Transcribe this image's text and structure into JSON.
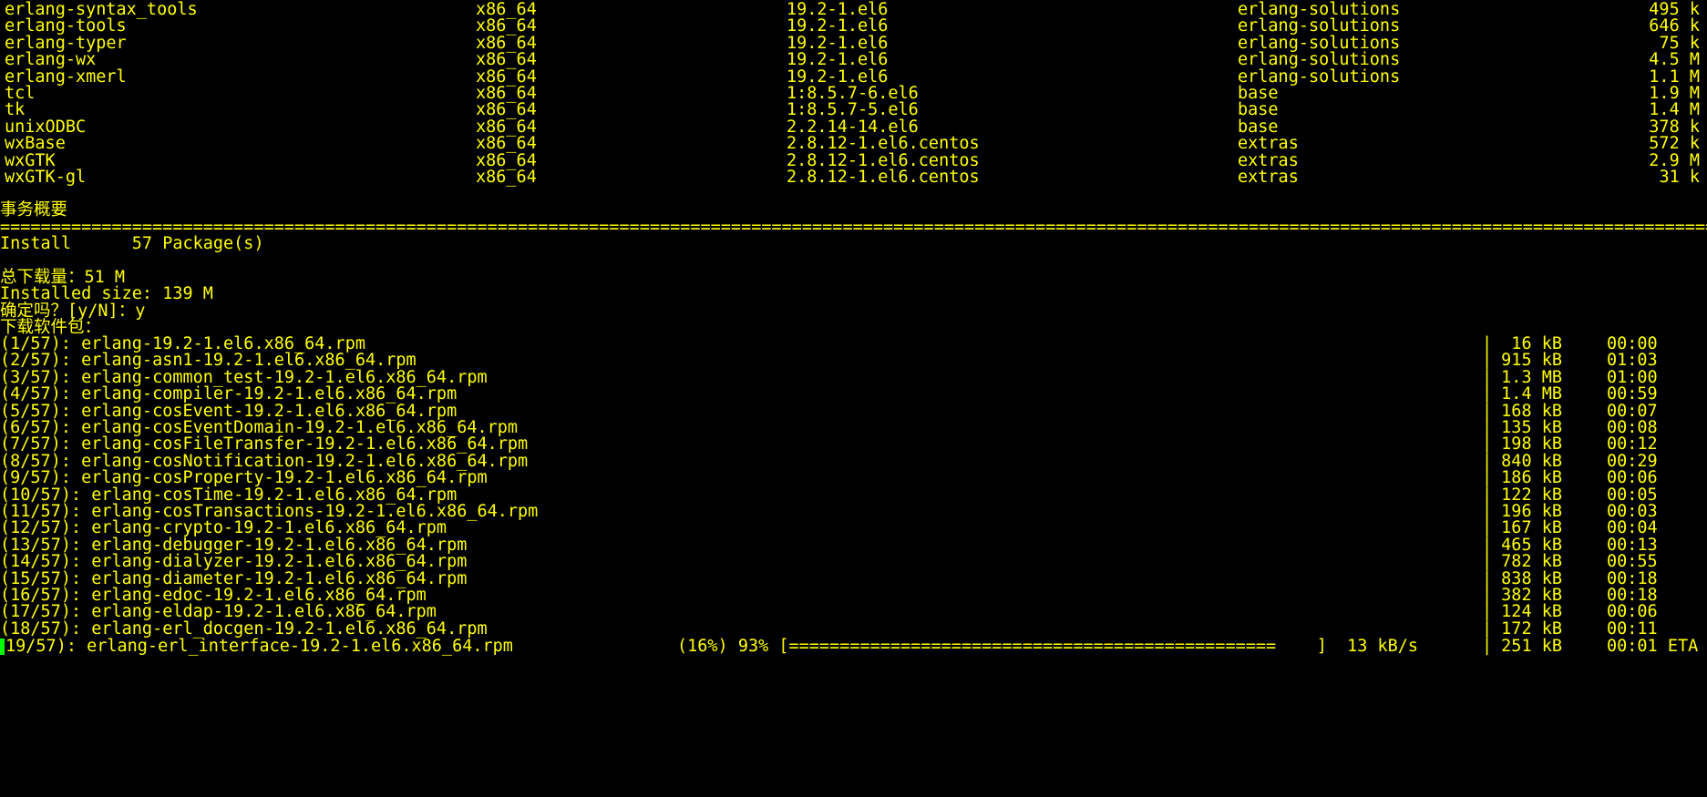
{
  "theme": {
    "foreground": "#ffff00",
    "background": "#000000",
    "cursor": "#00ff00"
  },
  "packages": [
    {
      "name": "erlang-syntax_tools",
      "arch": "x86_64",
      "version": "19.2-1.el6",
      "repo": "erlang-solutions",
      "size": "495 k"
    },
    {
      "name": "erlang-tools",
      "arch": "x86_64",
      "version": "19.2-1.el6",
      "repo": "erlang-solutions",
      "size": "646 k"
    },
    {
      "name": "erlang-typer",
      "arch": "x86_64",
      "version": "19.2-1.el6",
      "repo": "erlang-solutions",
      "size": "75 k"
    },
    {
      "name": "erlang-wx",
      "arch": "x86_64",
      "version": "19.2-1.el6",
      "repo": "erlang-solutions",
      "size": "4.5 M"
    },
    {
      "name": "erlang-xmerl",
      "arch": "x86_64",
      "version": "19.2-1.el6",
      "repo": "erlang-solutions",
      "size": "1.1 M"
    },
    {
      "name": "tcl",
      "arch": "x86_64",
      "version": "1:8.5.7-6.el6",
      "repo": "base",
      "size": "1.9 M"
    },
    {
      "name": "tk",
      "arch": "x86_64",
      "version": "1:8.5.7-5.el6",
      "repo": "base",
      "size": "1.4 M"
    },
    {
      "name": "unixODBC",
      "arch": "x86_64",
      "version": "2.2.14-14.el6",
      "repo": "base",
      "size": "378 k"
    },
    {
      "name": "wxBase",
      "arch": "x86_64",
      "version": "2.8.12-1.el6.centos",
      "repo": "extras",
      "size": "572 k"
    },
    {
      "name": "wxGTK",
      "arch": "x86_64",
      "version": "2.8.12-1.el6.centos",
      "repo": "extras",
      "size": "2.9 M"
    },
    {
      "name": "wxGTK-gl",
      "arch": "x86_64",
      "version": "2.8.12-1.el6.centos",
      "repo": "extras",
      "size": "31 k"
    }
  ],
  "summary": {
    "title": "事务概要",
    "separator_char": "=",
    "install_line": "Install      57 Package(s)",
    "download_total": "总下载量：51 M",
    "installed_size": "Installed size: 139 M",
    "confirm_prompt": "确定吗？[y/N]：y",
    "downloading": "下载软件包："
  },
  "downloads": [
    {
      "file": "(1/57): erlang-19.2-1.el6.x86_64.rpm",
      "size": " 16 kB",
      "time": "00:00"
    },
    {
      "file": "(2/57): erlang-asn1-19.2-1.el6.x86_64.rpm",
      "size": "915 kB",
      "time": "01:03"
    },
    {
      "file": "(3/57): erlang-common_test-19.2-1.el6.x86_64.rpm",
      "size": "1.3 MB",
      "time": "01:00"
    },
    {
      "file": "(4/57): erlang-compiler-19.2-1.el6.x86_64.rpm",
      "size": "1.4 MB",
      "time": "00:59"
    },
    {
      "file": "(5/57): erlang-cosEvent-19.2-1.el6.x86_64.rpm",
      "size": "168 kB",
      "time": "00:07"
    },
    {
      "file": "(6/57): erlang-cosEventDomain-19.2-1.el6.x86_64.rpm",
      "size": "135 kB",
      "time": "00:08"
    },
    {
      "file": "(7/57): erlang-cosFileTransfer-19.2-1.el6.x86_64.rpm",
      "size": "198 kB",
      "time": "00:12"
    },
    {
      "file": "(8/57): erlang-cosNotification-19.2-1.el6.x86_64.rpm",
      "size": "840 kB",
      "time": "00:29"
    },
    {
      "file": "(9/57): erlang-cosProperty-19.2-1.el6.x86_64.rpm",
      "size": "186 kB",
      "time": "00:06"
    },
    {
      "file": "(10/57): erlang-cosTime-19.2-1.el6.x86_64.rpm",
      "size": "122 kB",
      "time": "00:05"
    },
    {
      "file": "(11/57): erlang-cosTransactions-19.2-1.el6.x86_64.rpm",
      "size": "196 kB",
      "time": "00:03"
    },
    {
      "file": "(12/57): erlang-crypto-19.2-1.el6.x86_64.rpm",
      "size": "167 kB",
      "time": "00:04"
    },
    {
      "file": "(13/57): erlang-debugger-19.2-1.el6.x86_64.rpm",
      "size": "465 kB",
      "time": "00:13"
    },
    {
      "file": "(14/57): erlang-dialyzer-19.2-1.el6.x86_64.rpm",
      "size": "782 kB",
      "time": "00:55"
    },
    {
      "file": "(15/57): erlang-diameter-19.2-1.el6.x86_64.rpm",
      "size": "838 kB",
      "time": "00:18"
    },
    {
      "file": "(16/57): erlang-edoc-19.2-1.el6.x86_64.rpm",
      "size": "382 kB",
      "time": "00:18"
    },
    {
      "file": "(17/57): erlang-eldap-19.2-1.el6.x86_64.rpm",
      "size": "124 kB",
      "time": "00:06"
    },
    {
      "file": "(18/57): erlang-erl_docgen-19.2-1.el6.x86_64.rpm",
      "size": "172 kB",
      "time": "00:11"
    }
  ],
  "current": {
    "file": "19/57): erlang-erl_interface-19.2-1.el6.x86_64.rpm",
    "progress": "(16%) 93% [================================================    ]  13 kB/s",
    "size": "251 kB",
    "time": "00:01 ETA"
  }
}
